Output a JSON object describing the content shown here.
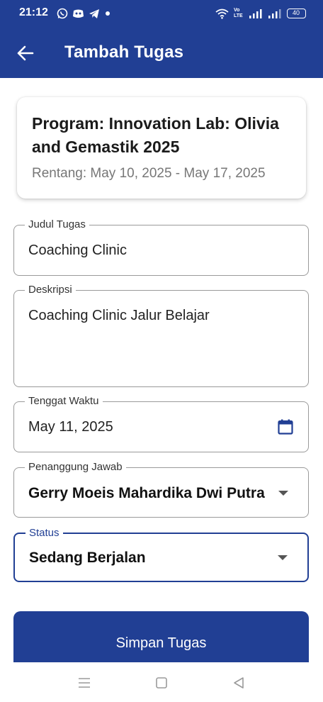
{
  "status_bar": {
    "time": "21:12",
    "battery": "40",
    "network": "Vo LTE"
  },
  "header": {
    "title": "Tambah Tugas"
  },
  "program_card": {
    "title": "Program: Innovation Lab: Olivia and Gemastik 2025",
    "range": "Rentang: May 10, 2025 - May 17, 2025"
  },
  "form": {
    "title_field": {
      "label": "Judul Tugas",
      "value": "Coaching Clinic"
    },
    "description_field": {
      "label": "Deskripsi",
      "value": "Coaching Clinic Jalur Belajar"
    },
    "deadline_field": {
      "label": "Tenggat Waktu",
      "value": "May 11, 2025"
    },
    "assignee_field": {
      "label": "Penanggung Jawab",
      "value": "Gerry Moeis Mahardika Dwi Putra"
    },
    "status_field": {
      "label": "Status",
      "value": "Sedang Berjalan"
    }
  },
  "actions": {
    "save_label": "Simpan Tugas"
  },
  "colors": {
    "primary": "#213f94",
    "background": "#ffffff",
    "field_border": "#9a9a9a"
  }
}
